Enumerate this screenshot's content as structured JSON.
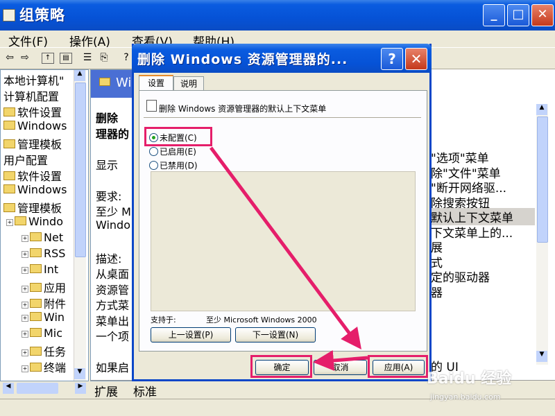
{
  "main": {
    "title": "组策略",
    "menu": [
      "文件(F)",
      "操作(A)",
      "查看(V)",
      "帮助(H)"
    ],
    "tree": [
      {
        "label": "本地计算机\"",
        "indent": 0,
        "folder": false
      },
      {
        "label": "计算机配置",
        "indent": 0,
        "folder": false
      },
      {
        "label": "软件设置",
        "indent": 0,
        "folder": true
      },
      {
        "label": "Windows",
        "indent": 0,
        "folder": true
      },
      {
        "label": "管理模板",
        "indent": 0,
        "folder": true
      },
      {
        "label": "用户配置",
        "indent": 0,
        "folder": false
      },
      {
        "label": "软件设置",
        "indent": 0,
        "folder": true
      },
      {
        "label": "Windows",
        "indent": 0,
        "folder": true
      },
      {
        "label": "管理模板",
        "indent": 0,
        "folder": true
      },
      {
        "label": "Windo",
        "indent": 1,
        "folder": true
      },
      {
        "label": "Net",
        "indent": 2,
        "folder": true
      },
      {
        "label": "RSS",
        "indent": 2,
        "folder": true
      },
      {
        "label": "Int",
        "indent": 2,
        "folder": true
      },
      {
        "label": "应用",
        "indent": 2,
        "folder": true
      },
      {
        "label": "附件",
        "indent": 2,
        "folder": true
      },
      {
        "label": "Win",
        "indent": 2,
        "folder": true
      },
      {
        "label": "Mic",
        "indent": 2,
        "folder": true
      },
      {
        "label": "任务",
        "indent": 2,
        "folder": true
      },
      {
        "label": "终端",
        "indent": 2,
        "folder": true
      }
    ],
    "desc_header": "Wi",
    "desc_lines": [
      "删除",
      "理器的",
      "",
      "显示 ",
      "",
      "要求:",
      "至少 M",
      "Windo",
      "",
      "描述:",
      "从桌面",
      "资源管",
      "方式菜",
      "菜单出",
      "一个项",
      "",
      "如果启"
    ],
    "list_items": [
      "\"选项\"菜单",
      "除\"文件\"菜单",
      "\"断开网络驱...",
      "除搜索按钮",
      "默认上下文菜单",
      "下文菜单上的...",
      "展",
      "式",
      "定的驱动器",
      "器",
      "",
      "",
      "",
      "",
      "的 UI"
    ],
    "bottom_tabs": [
      "扩展",
      "标准"
    ]
  },
  "dialog": {
    "title": "删除 Windows 资源管理器的...",
    "help": "?",
    "close": "✕",
    "tabs": [
      "设置",
      "说明"
    ],
    "policy_name": "删除 Windows 资源管理器的默认上下文菜单",
    "options": [
      {
        "label": "未配置(C)",
        "checked": true
      },
      {
        "label": "已启用(E)",
        "checked": false
      },
      {
        "label": "已禁用(D)",
        "checked": false
      }
    ],
    "supported_label": "支持于:",
    "supported_value": "至少 Microsoft Windows 2000",
    "prev_button": "上一设置(P)",
    "next_button": "下一设置(N)",
    "ok_button": "确定",
    "cancel_button": "取消",
    "apply_button": "应用(A)"
  },
  "watermark": {
    "brand": "Baidu 经验",
    "url": "jingyan.baidu.com"
  },
  "colors": {
    "highlight": "#e51e6a",
    "title_blue": "#0652d6"
  }
}
